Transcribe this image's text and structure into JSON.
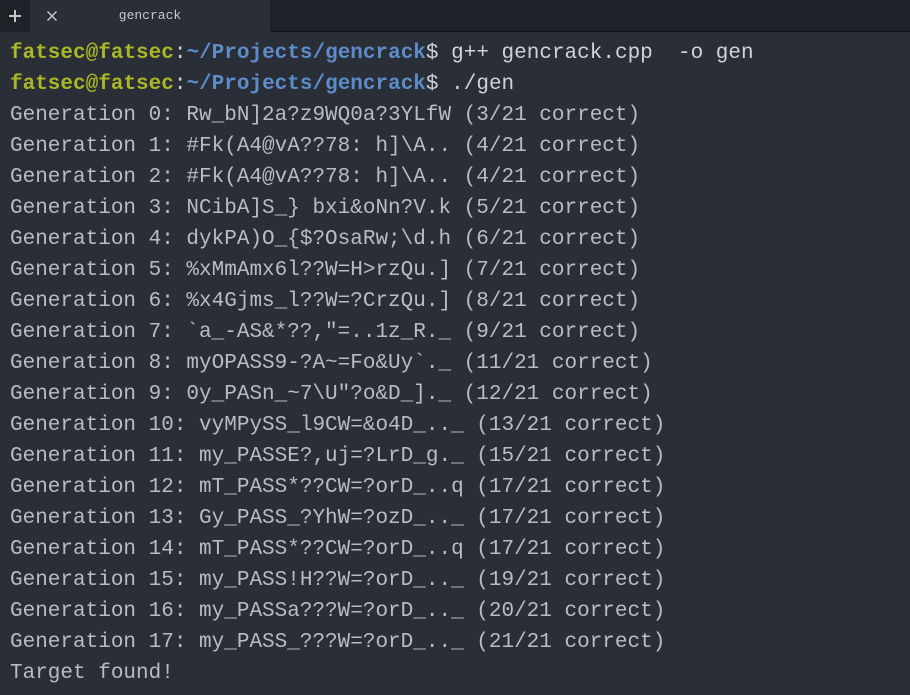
{
  "tab": {
    "title": "gencrack"
  },
  "prompt": {
    "user": "fatsec",
    "host": "fatsec",
    "path": "~/Projects/gencrack",
    "symbol": "$"
  },
  "commands": [
    "g++ gencrack.cpp  -o gen",
    "./gen"
  ],
  "output": [
    "Generation 0: Rw_bN]2a?z9WQ0a?3YLfW (3/21 correct)",
    "Generation 1: #Fk(A4@vA??78: h]\\A.. (4/21 correct)",
    "Generation 2: #Fk(A4@vA??78: h]\\A.. (4/21 correct)",
    "Generation 3: NCibA]S_} bxi&oNn?V.k (5/21 correct)",
    "Generation 4: dykPA)O_{$?OsaRw;\\d.h (6/21 correct)",
    "Generation 5: %xMmAmx6l??W=H>rzQu.] (7/21 correct)",
    "Generation 6: %x4Gjms_l??W=?CrzQu.] (8/21 correct)",
    "Generation 7: `a_-AS&*??,\"=..1z_R._ (9/21 correct)",
    "Generation 8: myOPASS9-?A~=Fo&Uy`._ (11/21 correct)",
    "Generation 9: 0y_PASn_~7\\U\"?o&D_]._ (12/21 correct)",
    "Generation 10: vyMPySS_l9CW=&o4D_.._ (13/21 correct)",
    "Generation 11: my_PASSE?,uj=?LrD_g._ (15/21 correct)",
    "Generation 12: mT_PASS*??CW=?orD_..q (17/21 correct)",
    "Generation 13: Gy_PASS_?YhW=?ozD_.._ (17/21 correct)",
    "Generation 14: mT_PASS*??CW=?orD_..q (17/21 correct)",
    "Generation 15: my_PASS!H??W=?orD_.._ (19/21 correct)",
    "Generation 16: my_PASSa???W=?orD_.._ (20/21 correct)",
    "Generation 17: my_PASS_???W=?orD_.._ (21/21 correct)",
    "Target found!"
  ]
}
